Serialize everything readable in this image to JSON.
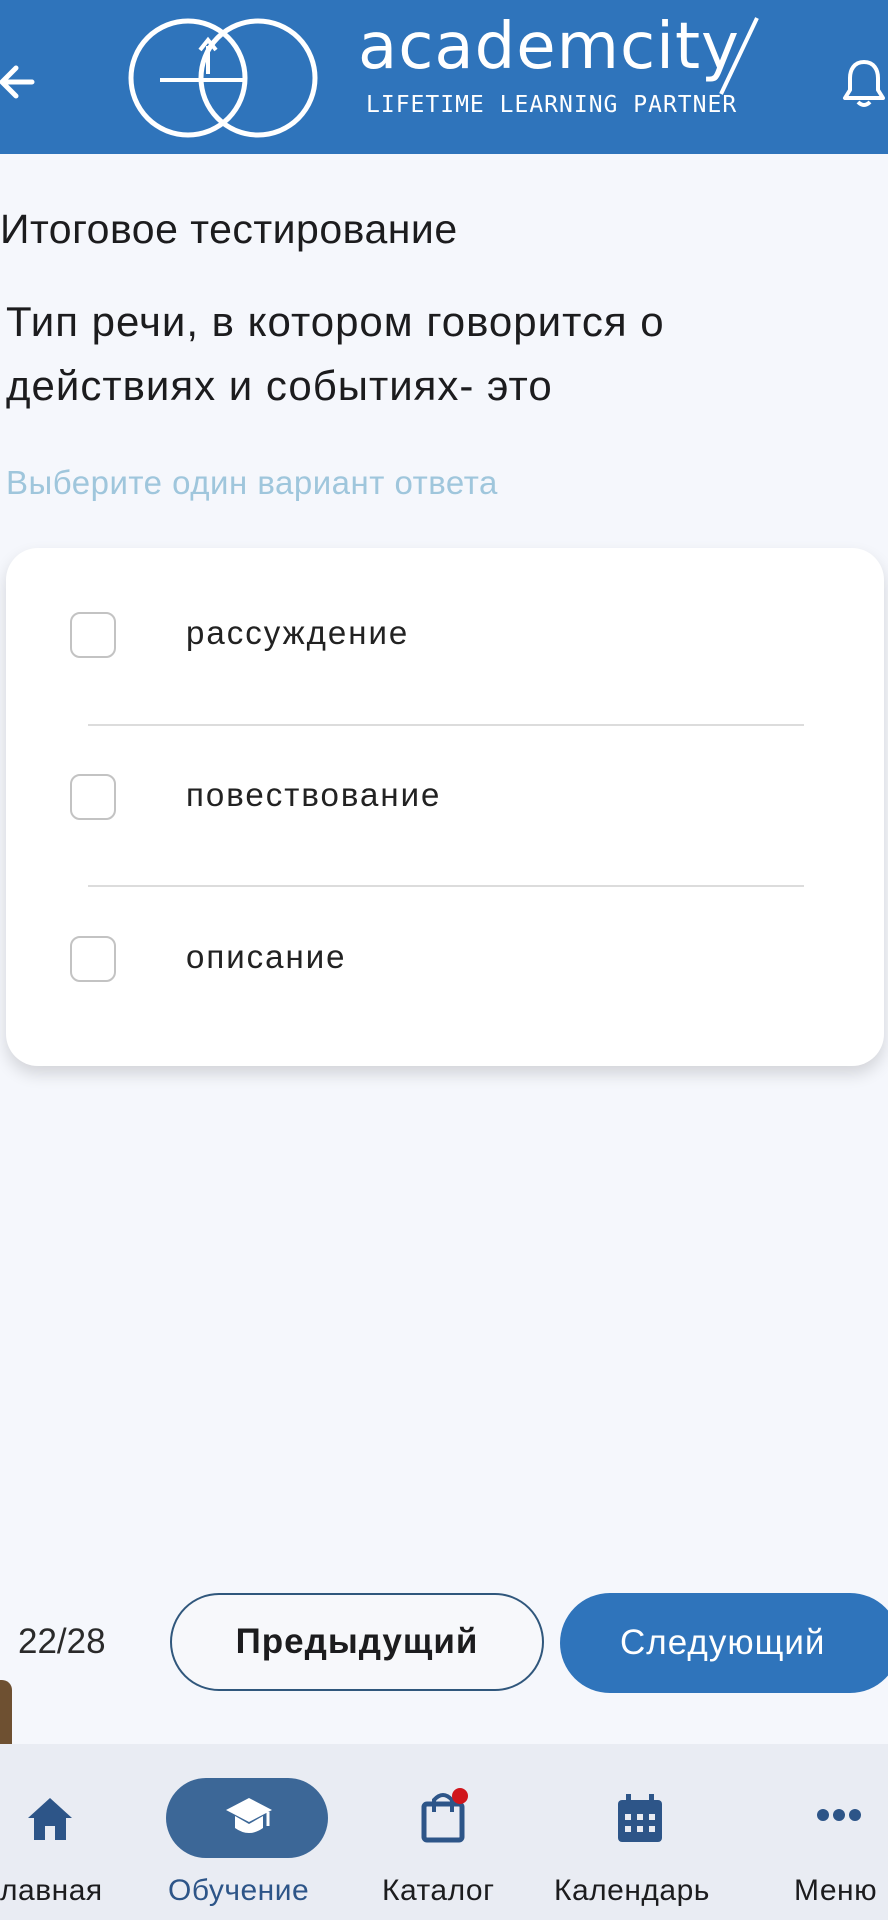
{
  "header": {
    "logo_word": "academcity",
    "logo_tagline": "LIFETIME LEARNING PARTNER",
    "color": "#2f74bb",
    "back_icon": "arrow-left-icon",
    "bell_icon": "bell-icon"
  },
  "page_title": "Итоговое тестирование",
  "question": "Тип речи, в котором говорится о действиях и событиях- это",
  "hint": "Выберите один вариант ответа",
  "options": [
    {
      "label": "рассуждение",
      "checked": false
    },
    {
      "label": "повествование",
      "checked": false
    },
    {
      "label": "описание",
      "checked": false
    }
  ],
  "navigation": {
    "progress": "22/28",
    "prev_label": "Предыдущий",
    "next_label": "Следующий"
  },
  "tabbar": {
    "items": [
      {
        "label": "лавная",
        "icon": "home-icon",
        "active": false
      },
      {
        "label": "Обучение",
        "icon": "graduation-cap-icon",
        "active": true
      },
      {
        "label": "Каталог",
        "icon": "shopping-bag-icon",
        "active": false,
        "badge_color": "#d0161c"
      },
      {
        "label": "Календарь",
        "icon": "calendar-icon",
        "active": false
      },
      {
        "label": "Меню",
        "icon": "more-icon",
        "active": false
      }
    ],
    "active_color": "#3c6797",
    "icon_color": "#2d5588"
  }
}
